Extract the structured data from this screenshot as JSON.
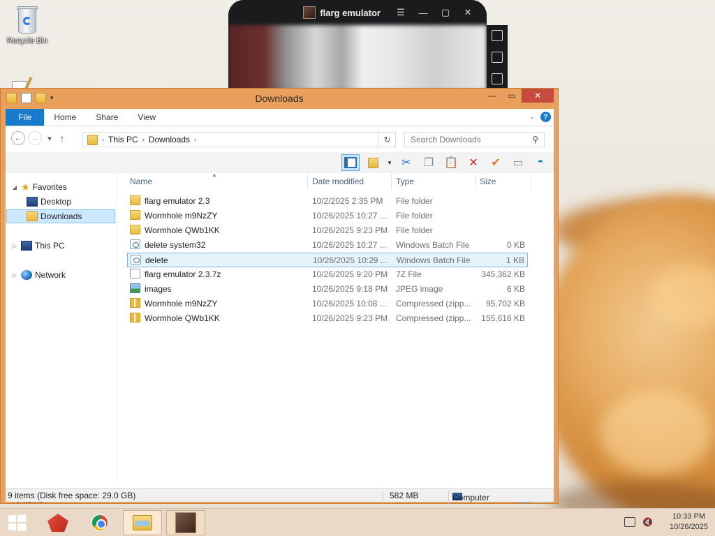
{
  "desktop": {
    "icons": [
      {
        "label": "Recycle Bin",
        "icon": "recycle-bin-icon"
      },
      {
        "label": "",
        "icon": "document-pen-icon"
      }
    ]
  },
  "emulator": {
    "title": "flarg emulator",
    "controls": {
      "menu": "☰",
      "minimize": "—",
      "maximize": "▢",
      "close": "✕"
    },
    "side_buttons": [
      "fullscreen-icon",
      "keyboard-icon",
      "apk-install-icon"
    ]
  },
  "explorer": {
    "title": "Downloads",
    "window_controls": {
      "minimize": "—",
      "maximize": "▭",
      "close": "✕"
    },
    "ribbon_tabs": [
      "File",
      "Home",
      "Share",
      "View"
    ],
    "address": {
      "crumbs": [
        "This PC",
        "Downloads"
      ],
      "search_placeholder": "Search Downloads"
    },
    "columns": [
      "Name",
      "Date modified",
      "Type",
      "Size"
    ],
    "nav": {
      "favorites": "Favorites",
      "desktop": "Desktop",
      "downloads": "Downloads",
      "this_pc": "This PC",
      "network": "Network"
    },
    "files": [
      {
        "name": "flarg emulator 2.3",
        "date": "10/2/2025 2:35 PM",
        "type": "File folder",
        "size": "",
        "icon": "folder-icon"
      },
      {
        "name": "Wormhole m9NzZY",
        "date": "10/26/2025 10:27 ...",
        "type": "File folder",
        "size": "",
        "icon": "folder-icon"
      },
      {
        "name": "Wormhole QWb1KK",
        "date": "10/26/2025 9:23 PM",
        "type": "File folder",
        "size": "",
        "icon": "folder-icon"
      },
      {
        "name": "delete system32",
        "date": "10/26/2025 10:27 ...",
        "type": "Windows Batch File",
        "size": "0 KB",
        "icon": "batch-file-icon"
      },
      {
        "name": "delete",
        "date": "10/26/2025 10:29 ...",
        "type": "Windows Batch File",
        "size": "1 KB",
        "icon": "batch-file-icon"
      },
      {
        "name": "flarg emulator 2.3.7z",
        "date": "10/26/2025 9:20 PM",
        "type": "7Z File",
        "size": "345,362 KB",
        "icon": "blank-file-icon"
      },
      {
        "name": "images",
        "date": "10/26/2025 9:18 PM",
        "type": "JPEG image",
        "size": "6 KB",
        "icon": "image-file-icon"
      },
      {
        "name": "Wormhole m9NzZY",
        "date": "10/26/2025 10:08 ...",
        "type": "Compressed (zipp...",
        "size": "95,702 KB",
        "icon": "zip-folder-icon"
      },
      {
        "name": "Wormhole QWb1KK",
        "date": "10/26/2025 9:23 PM",
        "type": "Compressed (zipp...",
        "size": "155,616 KB",
        "icon": "zip-folder-icon"
      }
    ],
    "selected_index": 4,
    "items_count": "9 items",
    "status": {
      "left": "9 items (Disk free space: 29.0 GB)",
      "size": "582 MB",
      "location": "Computer"
    }
  },
  "taskbar": {
    "apps": [
      "start-icon",
      "red-app-icon",
      "chrome-icon",
      "file-explorer-icon",
      "flarg-emulator-icon"
    ],
    "clock_time": "10:33 PM",
    "clock_date": "10/26/2025"
  }
}
